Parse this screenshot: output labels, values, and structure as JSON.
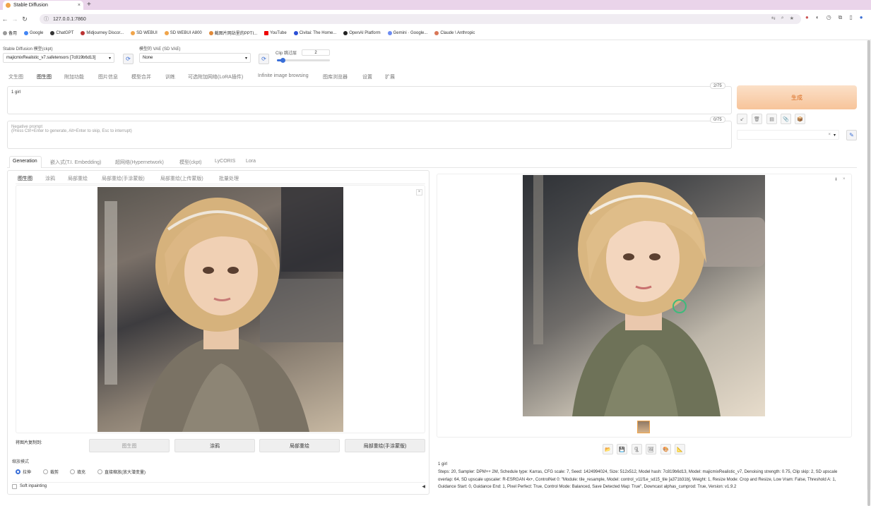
{
  "browser": {
    "tab_title": "Stable Diffusion",
    "tab_close": "×",
    "new_tab": "+",
    "url": "127.0.0.1:7860",
    "bookmarks": [
      "备用",
      "Google",
      "ChatGPT",
      "Midjourney Discor...",
      "SD WEBUI",
      "SD WEBUI A800",
      "截图片网站里的PPTI...",
      "YouTube",
      "Civitai: The Home...",
      "OpenAI Platform",
      "Gemini · Google...",
      "Claude \\ Anthropic"
    ]
  },
  "top": {
    "model_label": "Stable Diffusion 模型(ckpt)",
    "model_value": "majicmixRealistic_v7.safetensors [7c819b6d13]",
    "vae_label": "模型的 VAE (SD VAE)",
    "vae_value": "None",
    "clip_label": "Clip 跳过层",
    "clip_value": "2",
    "clip_fraction": 0.1
  },
  "main_tabs": [
    "文生图",
    "图生图",
    "附加功能",
    "图片信息",
    "模型合并",
    "训练",
    "可选附加网络(LoRA插件)",
    "Infinite image browsing",
    "图库浏览器",
    "设置",
    "扩展"
  ],
  "prompt": {
    "positive": "1 girl",
    "positive_counter": "2/75",
    "negative_placeholder": "Negative prompt\n(Press Ctrl+Enter to generate, Alt+Enter to skip, Esc to interrupt)",
    "negative_counter": "0/75"
  },
  "generate_label": "生成",
  "tool_icons": [
    "↙",
    "🗑",
    "▤",
    "📎",
    "📦"
  ],
  "style_select_clear": "×",
  "style_select_caret": "▾",
  "edit_icon": "✎",
  "gen_tabs": [
    "Generation",
    "嵌入式(T.I. Embedding)",
    "超网络(Hypernetwork)",
    "模型(ckpt)",
    "LyCORIS",
    "Lora"
  ],
  "img2img_tabs": [
    "图生图",
    "涂鸦",
    "局部重绘",
    "局部重绘(手涂蒙版)",
    "局部重绘(上传蒙版)",
    "批量处理"
  ],
  "input_close": "×",
  "copy_label": "将图片复制到:",
  "copy_buttons": [
    "图生图",
    "涂鸦",
    "局部重绘",
    "局部重绘(手涂蒙版)"
  ],
  "resize_label": "缩放模式",
  "resize_modes": [
    "拉伸",
    "裁剪",
    "填充",
    "直接缩放(放大潜变量)"
  ],
  "soft_inpainting": "Soft inpainting",
  "soft_caret": "◀",
  "output_icons": [
    "📂",
    "💾",
    "🗜",
    "🖼",
    "🎨",
    "📐"
  ],
  "output_corner": [
    "⬇",
    "×"
  ],
  "info_prompt": "1 girl",
  "info_params_1": "Steps: 20, Sampler: DPM++ 2M, Schedule type: Karras, CFG scale: 7, Seed: 1424994024, Size: 512x512, Model hash: 7c819b6d13, Model: majicmixRealistic_v7, Denoising strength: 0.75, Clip skip: 2, SD upscale",
  "info_params_2": "overlap: 64, SD upscale upscaler: R-ESRGAN 4x+, ControlNet 0: \"Module: tile_resample, Model: control_v11f1e_sd15_tile [a371b31b], Weight: 1, Resize Mode: Crop and Resize, Low Vram: False, Threshold A: 1,",
  "info_params_3": "Guidance Start: 0, Guidance End: 1, Pixel Perfect: True, Control Mode: Balanced, Save Detected Map: True\", Downcast alphas_cumprod: True, Version: v1.9.2"
}
